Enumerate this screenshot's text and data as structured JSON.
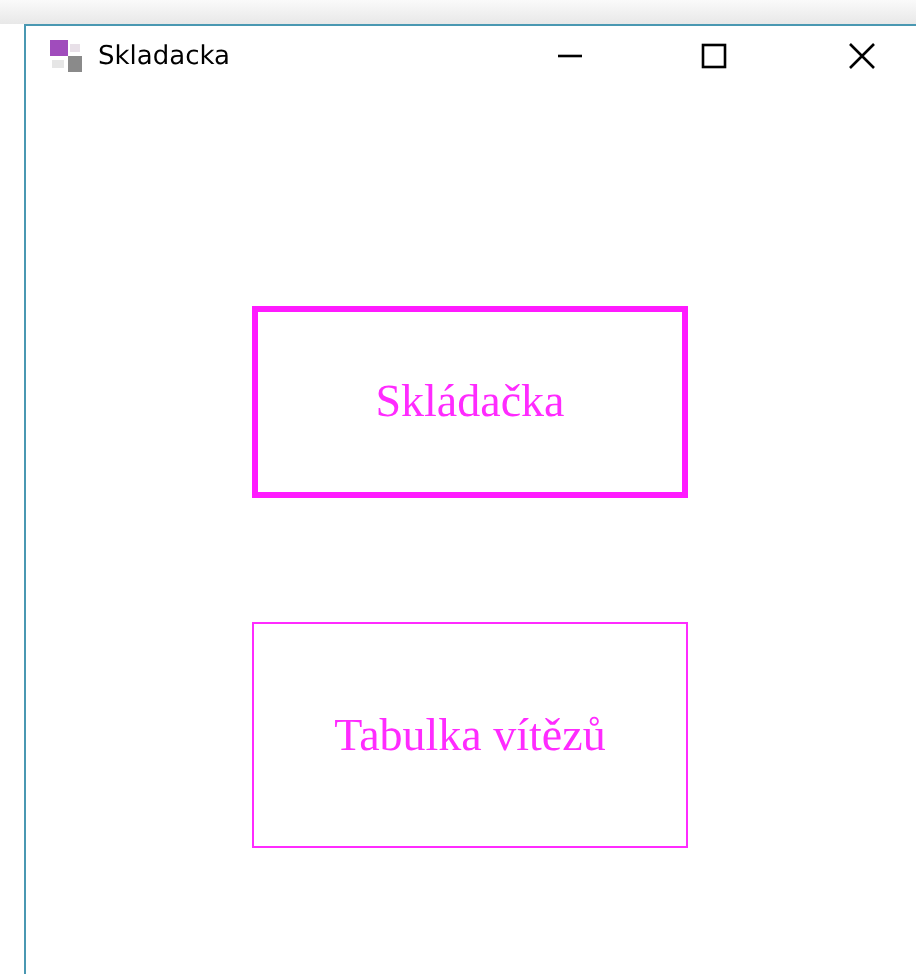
{
  "window": {
    "title": "Skladacka"
  },
  "buttons": [
    {
      "label": "Skládačka",
      "focused": true
    },
    {
      "label": "Tabulka vítězů",
      "focused": false
    }
  ]
}
